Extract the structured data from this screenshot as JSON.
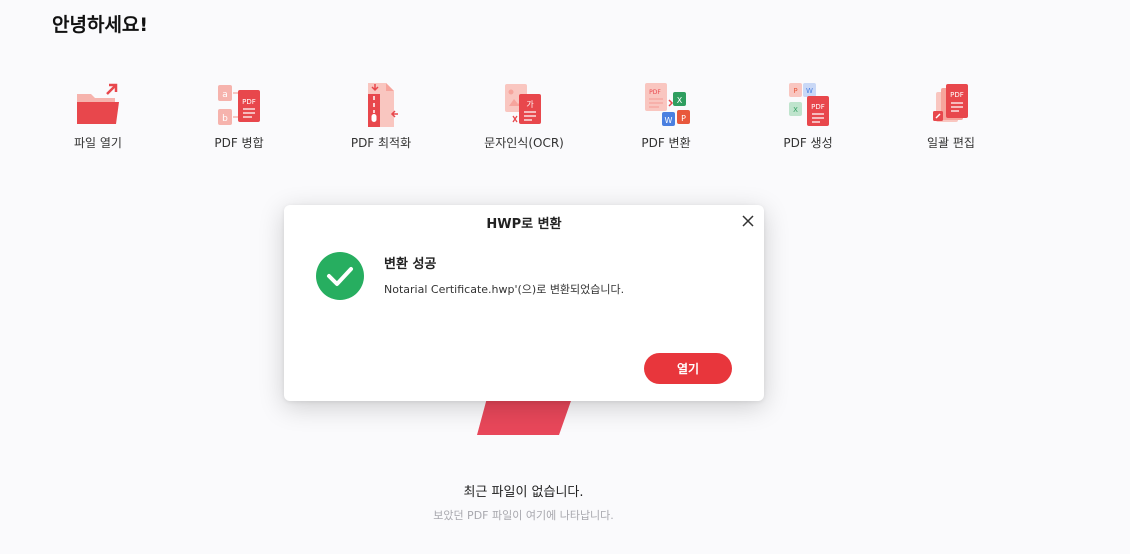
{
  "greeting": "안녕하세요!",
  "tools": [
    {
      "label": "파일 열기",
      "icon": "folder-open-icon"
    },
    {
      "label": "PDF 병합",
      "icon": "pdf-merge-icon"
    },
    {
      "label": "PDF 최적화",
      "icon": "pdf-compress-icon"
    },
    {
      "label": "문자인식(OCR)",
      "icon": "ocr-icon"
    },
    {
      "label": "PDF 변환",
      "icon": "pdf-convert-icon"
    },
    {
      "label": "PDF 생성",
      "icon": "pdf-create-icon"
    },
    {
      "label": "일괄 편집",
      "icon": "batch-edit-icon"
    }
  ],
  "icon_text": {
    "pdf": "PDF",
    "a": "a",
    "b": "b",
    "ga": "가",
    "x": "X",
    "w": "W",
    "p": "P"
  },
  "empty": {
    "title": "최근 파일이 없습니다.",
    "subtitle": "보았던 PDF 파일이 여기에 나타납니다."
  },
  "dialog": {
    "title": "HWP로 변환",
    "message_title": "변환 성공",
    "message_body": "Notarial Certificate.hwp'(으)로 변환되었습니다.",
    "open_label": "열기"
  },
  "colors": {
    "accent": "#e8363c",
    "success": "#27ae60",
    "background": "#fafafc"
  }
}
